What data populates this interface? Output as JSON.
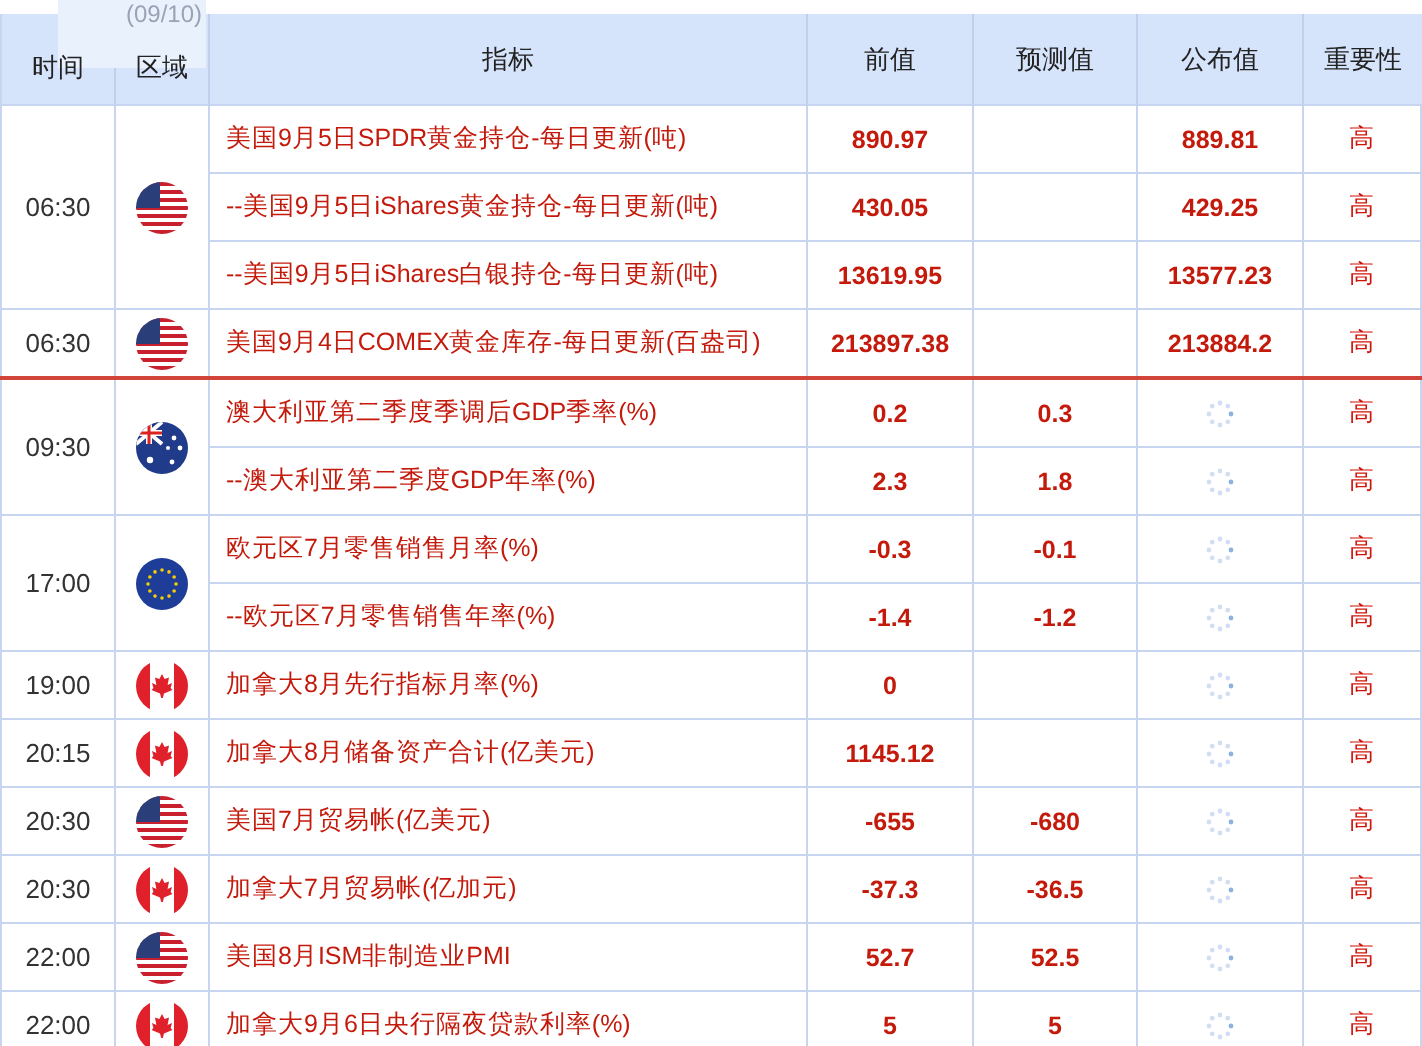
{
  "date_tab": "(09/10)",
  "columns": [
    "时间",
    "区域",
    "指标",
    "前值",
    "预测值",
    "公布值",
    "重要性"
  ],
  "groups": [
    {
      "time": "06:30",
      "kind": "us",
      "divider_below": false,
      "rows": [
        {
          "name": "美国9月5日SPDR黄金持仓-每日更新(吨)",
          "previous": "890.97",
          "actual": "889.81",
          "importance": "高"
        },
        {
          "name": "--美国9月5日iShares黄金持仓-每日更新(吨)",
          "previous": "430.05",
          "actual": "429.25",
          "importance": "高"
        },
        {
          "name": "--美国9月5日iShares白银持仓-每日更新(吨)",
          "previous": "13619.95",
          "actual": "13577.23",
          "importance": "高"
        }
      ]
    },
    {
      "time": "06:30",
      "kind": "us",
      "divider_below": true,
      "rows": [
        {
          "name": "美国9月4日COMEX黄金库存-每日更新(百盎司)",
          "previous": "213897.38",
          "actual": "213884.2",
          "importance": "高"
        }
      ]
    },
    {
      "time": "09:30",
      "kind": "au",
      "divider_below": false,
      "rows": [
        {
          "name": "澳大利亚第二季度季调后GDP季率(%)",
          "previous": "0.2",
          "forecast": "0.3",
          "importance": "高"
        },
        {
          "name": "--澳大利亚第二季度GDP年率(%)",
          "previous": "2.3",
          "forecast": "1.8",
          "importance": "高"
        }
      ]
    },
    {
      "time": "17:00",
      "kind": "eu",
      "divider_below": false,
      "rows": [
        {
          "name": "欧元区7月零售销售月率(%)",
          "previous": "-0.3",
          "forecast": "-0.1",
          "importance": "高"
        },
        {
          "name": "--欧元区7月零售销售年率(%)",
          "previous": "-1.4",
          "forecast": "-1.2",
          "importance": "高"
        }
      ]
    },
    {
      "time": "19:00",
      "kind": "ca",
      "divider_below": false,
      "rows": [
        {
          "name": "加拿大8月先行指标月率(%)",
          "previous": "0",
          "importance": "高"
        }
      ]
    },
    {
      "time": "20:15",
      "kind": "ca",
      "divider_below": false,
      "rows": [
        {
          "name": "加拿大8月储备资产合计(亿美元)",
          "previous": "1145.12",
          "importance": "高"
        }
      ]
    },
    {
      "time": "20:30",
      "kind": "us",
      "divider_below": false,
      "rows": [
        {
          "name": "美国7月贸易帐(亿美元)",
          "previous": "-655",
          "forecast": "-680",
          "importance": "高"
        }
      ]
    },
    {
      "time": "20:30",
      "kind": "ca",
      "divider_below": false,
      "rows": [
        {
          "name": "加拿大7月贸易帐(亿加元)",
          "previous": "-37.3",
          "forecast": "-36.5",
          "importance": "高"
        }
      ]
    },
    {
      "time": "22:00",
      "kind": "us",
      "divider_below": false,
      "rows": [
        {
          "name": "美国8月ISM非制造业PMI",
          "previous": "52.7",
          "forecast": "52.5",
          "importance": "高"
        }
      ]
    },
    {
      "time": "22:00",
      "kind": "ca",
      "divider_below": false,
      "rows": [
        {
          "name": "加拿大9月6日央行隔夜贷款利率(%)",
          "previous": "5",
          "forecast": "5",
          "importance": "高"
        }
      ]
    }
  ]
}
